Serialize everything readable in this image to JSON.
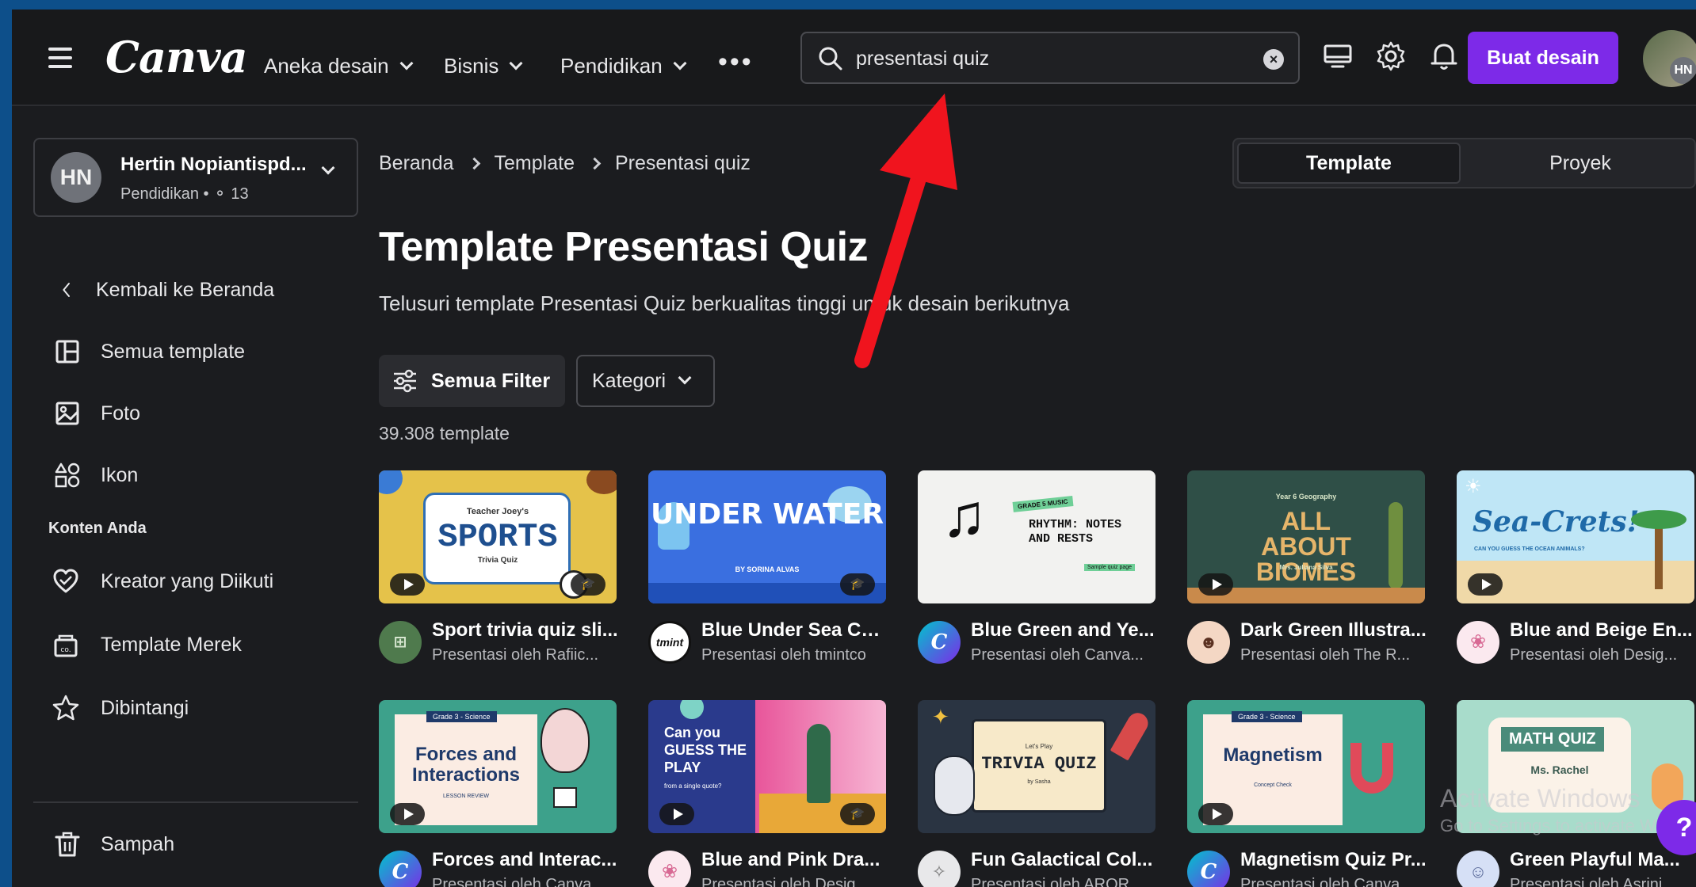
{
  "topbar": {
    "logo": "Canva",
    "nav": [
      "Aneka desain",
      "Bisnis",
      "Pendidikan"
    ],
    "search_value": "presentasi quiz",
    "create_label": "Buat desain",
    "avatar_initials": "HN"
  },
  "sidebar": {
    "account_name": "Hertin Nopiantispd...",
    "account_sub": "Pendidikan",
    "account_members": "13",
    "account_initials": "HN",
    "back_label": "Kembali ke Beranda",
    "items": [
      "Semua template",
      "Foto",
      "Ikon"
    ],
    "section_heading": "Konten Anda",
    "content_items": [
      "Kreator yang Diikuti",
      "Template Merek",
      "Dibintangi"
    ],
    "trash_label": "Sampah"
  },
  "main": {
    "breadcrumb": [
      "Beranda",
      "Template",
      "Presentasi quiz"
    ],
    "tabs": [
      "Template",
      "Proyek"
    ],
    "title": "Template Presentasi Quiz",
    "subtitle": "Telusuri template Presentasi Quiz berkualitas tinggi untuk desain berikutnya",
    "filter_label": "Semua Filter",
    "category_label": "Kategori",
    "count": "39.308 template",
    "row1": [
      {
        "title": "Sport trivia quiz sli...",
        "author": "Presentasi oleh Rafiic...",
        "thumb_title": "SPORTS",
        "thumb_top": "Teacher Joey's",
        "thumb_small": "Trivia Quiz"
      },
      {
        "title": "Blue Under Sea Co...",
        "author": "Presentasi oleh tmintco",
        "thumb_title": "UNDER WATER",
        "thumb_small": "BY SORINA ALVAS",
        "avatar_text": "tmint"
      },
      {
        "title": "Blue Green and Ye...",
        "author": "Presentasi oleh Canva...",
        "thumb_title": "RHYTHM: NOTES AND RESTS",
        "thumb_top": "GRADE 5 MUSIC",
        "thumb_small": "Sample quiz page",
        "avatar_text": "C"
      },
      {
        "title": "Dark Green Illustra...",
        "author": "Presentasi oleh The R...",
        "thumb_title": "ALL ABOUT BIOMES",
        "thumb_top": "Year 6 Geography",
        "thumb_small": "Mrs. Juliana Silva"
      },
      {
        "title": "Blue and Beige En...",
        "author": "Presentasi oleh Desig...",
        "thumb_title": "Sea-Crets!",
        "thumb_small": "CAN YOU GUESS THE OCEAN ANIMALS?"
      }
    ],
    "row2": [
      {
        "title": "Forces and Interac...",
        "author": "Presentasi oleh Canva...",
        "thumb_title": "Forces and Interactions",
        "thumb_top": "Grade 3 - Science",
        "thumb_small": "LESSON REVIEW",
        "avatar_text": "C"
      },
      {
        "title": "Blue and Pink Dra...",
        "author": "Presentasi oleh Desig...",
        "thumb_title": "Can you GUESS THE PLAY",
        "thumb_small": "from a single quote?"
      },
      {
        "title": "Fun Galactical Col...",
        "author": "Presentasi oleh AROR...",
        "thumb_title": "TRIVIA QUIZ",
        "thumb_top": "Let's Play",
        "thumb_small": "by Sasha"
      },
      {
        "title": "Magnetism Quiz Pr...",
        "author": "Presentasi oleh Canva...",
        "thumb_title": "Magnetism",
        "thumb_top": "Grade 3 - Science",
        "thumb_small": "Concept Check",
        "avatar_text": "C"
      },
      {
        "title": "Green Playful Ma...",
        "author": "Presentasi oleh Asrini...",
        "thumb_title": "MATH QUIZ",
        "thumb_small": "Ms. Rachel"
      }
    ]
  },
  "watermark": {
    "line1": "Activate Windows",
    "line2": "Go to Settings to activate W"
  },
  "help_label": "?",
  "colors": {
    "accent": "#7d2ae8",
    "annotation_arrow": "#f0141e",
    "background": "#1b1c1f"
  }
}
